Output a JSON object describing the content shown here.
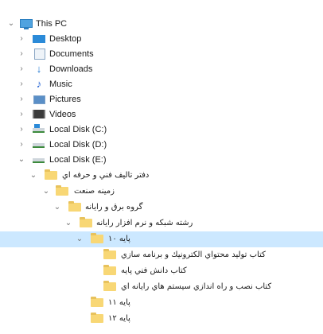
{
  "tree": {
    "items": [
      {
        "label": "This PC",
        "arrow": "⌄",
        "icon": "this-pc-icon"
      },
      {
        "label": "Desktop",
        "arrow": "›",
        "icon": "desktop-icon"
      },
      {
        "label": "Documents",
        "arrow": "›",
        "icon": "documents-icon"
      },
      {
        "label": "Downloads",
        "arrow": "›",
        "icon": "downloads-icon"
      },
      {
        "label": "Music",
        "arrow": "›",
        "icon": "music-icon"
      },
      {
        "label": "Pictures",
        "arrow": "›",
        "icon": "pictures-icon"
      },
      {
        "label": "Videos",
        "arrow": "›",
        "icon": "videos-icon"
      },
      {
        "label": "Local Disk (C:)",
        "arrow": "›",
        "icon": "system-disk-icon"
      },
      {
        "label": "Local Disk (D:)",
        "arrow": "›",
        "icon": "disk-icon"
      },
      {
        "label": "Local Disk (E:)",
        "arrow": "⌄",
        "icon": "disk-icon"
      },
      {
        "label": "دفتر تاليف فني و حرفه اي",
        "arrow": "⌄",
        "icon": "folder-icon"
      },
      {
        "label": "زمينه صنعت",
        "arrow": "⌄",
        "icon": "folder-icon"
      },
      {
        "label": "گروه برق و رايانه",
        "arrow": "⌄",
        "icon": "folder-icon"
      },
      {
        "label": "رشته شبكه و نرم افزار رايانه",
        "arrow": "⌄",
        "icon": "folder-icon"
      },
      {
        "label": "پايه ۱۰",
        "arrow": "⌄",
        "icon": "folder-icon",
        "selected": true
      },
      {
        "label": "كتاب توليد محتواي الكترونيك و برنامه سازي",
        "arrow": "",
        "icon": "folder-icon"
      },
      {
        "label": "كتاب دانش فني پايه",
        "arrow": "",
        "icon": "folder-icon"
      },
      {
        "label": "كتاب نصب و راه اندازي سيستم هاي رايانه اي",
        "arrow": "",
        "icon": "folder-icon"
      },
      {
        "label": "پايه ۱۱",
        "arrow": "",
        "icon": "folder-icon"
      },
      {
        "label": "پايه ۱۲",
        "arrow": "",
        "icon": "folder-icon"
      }
    ]
  }
}
